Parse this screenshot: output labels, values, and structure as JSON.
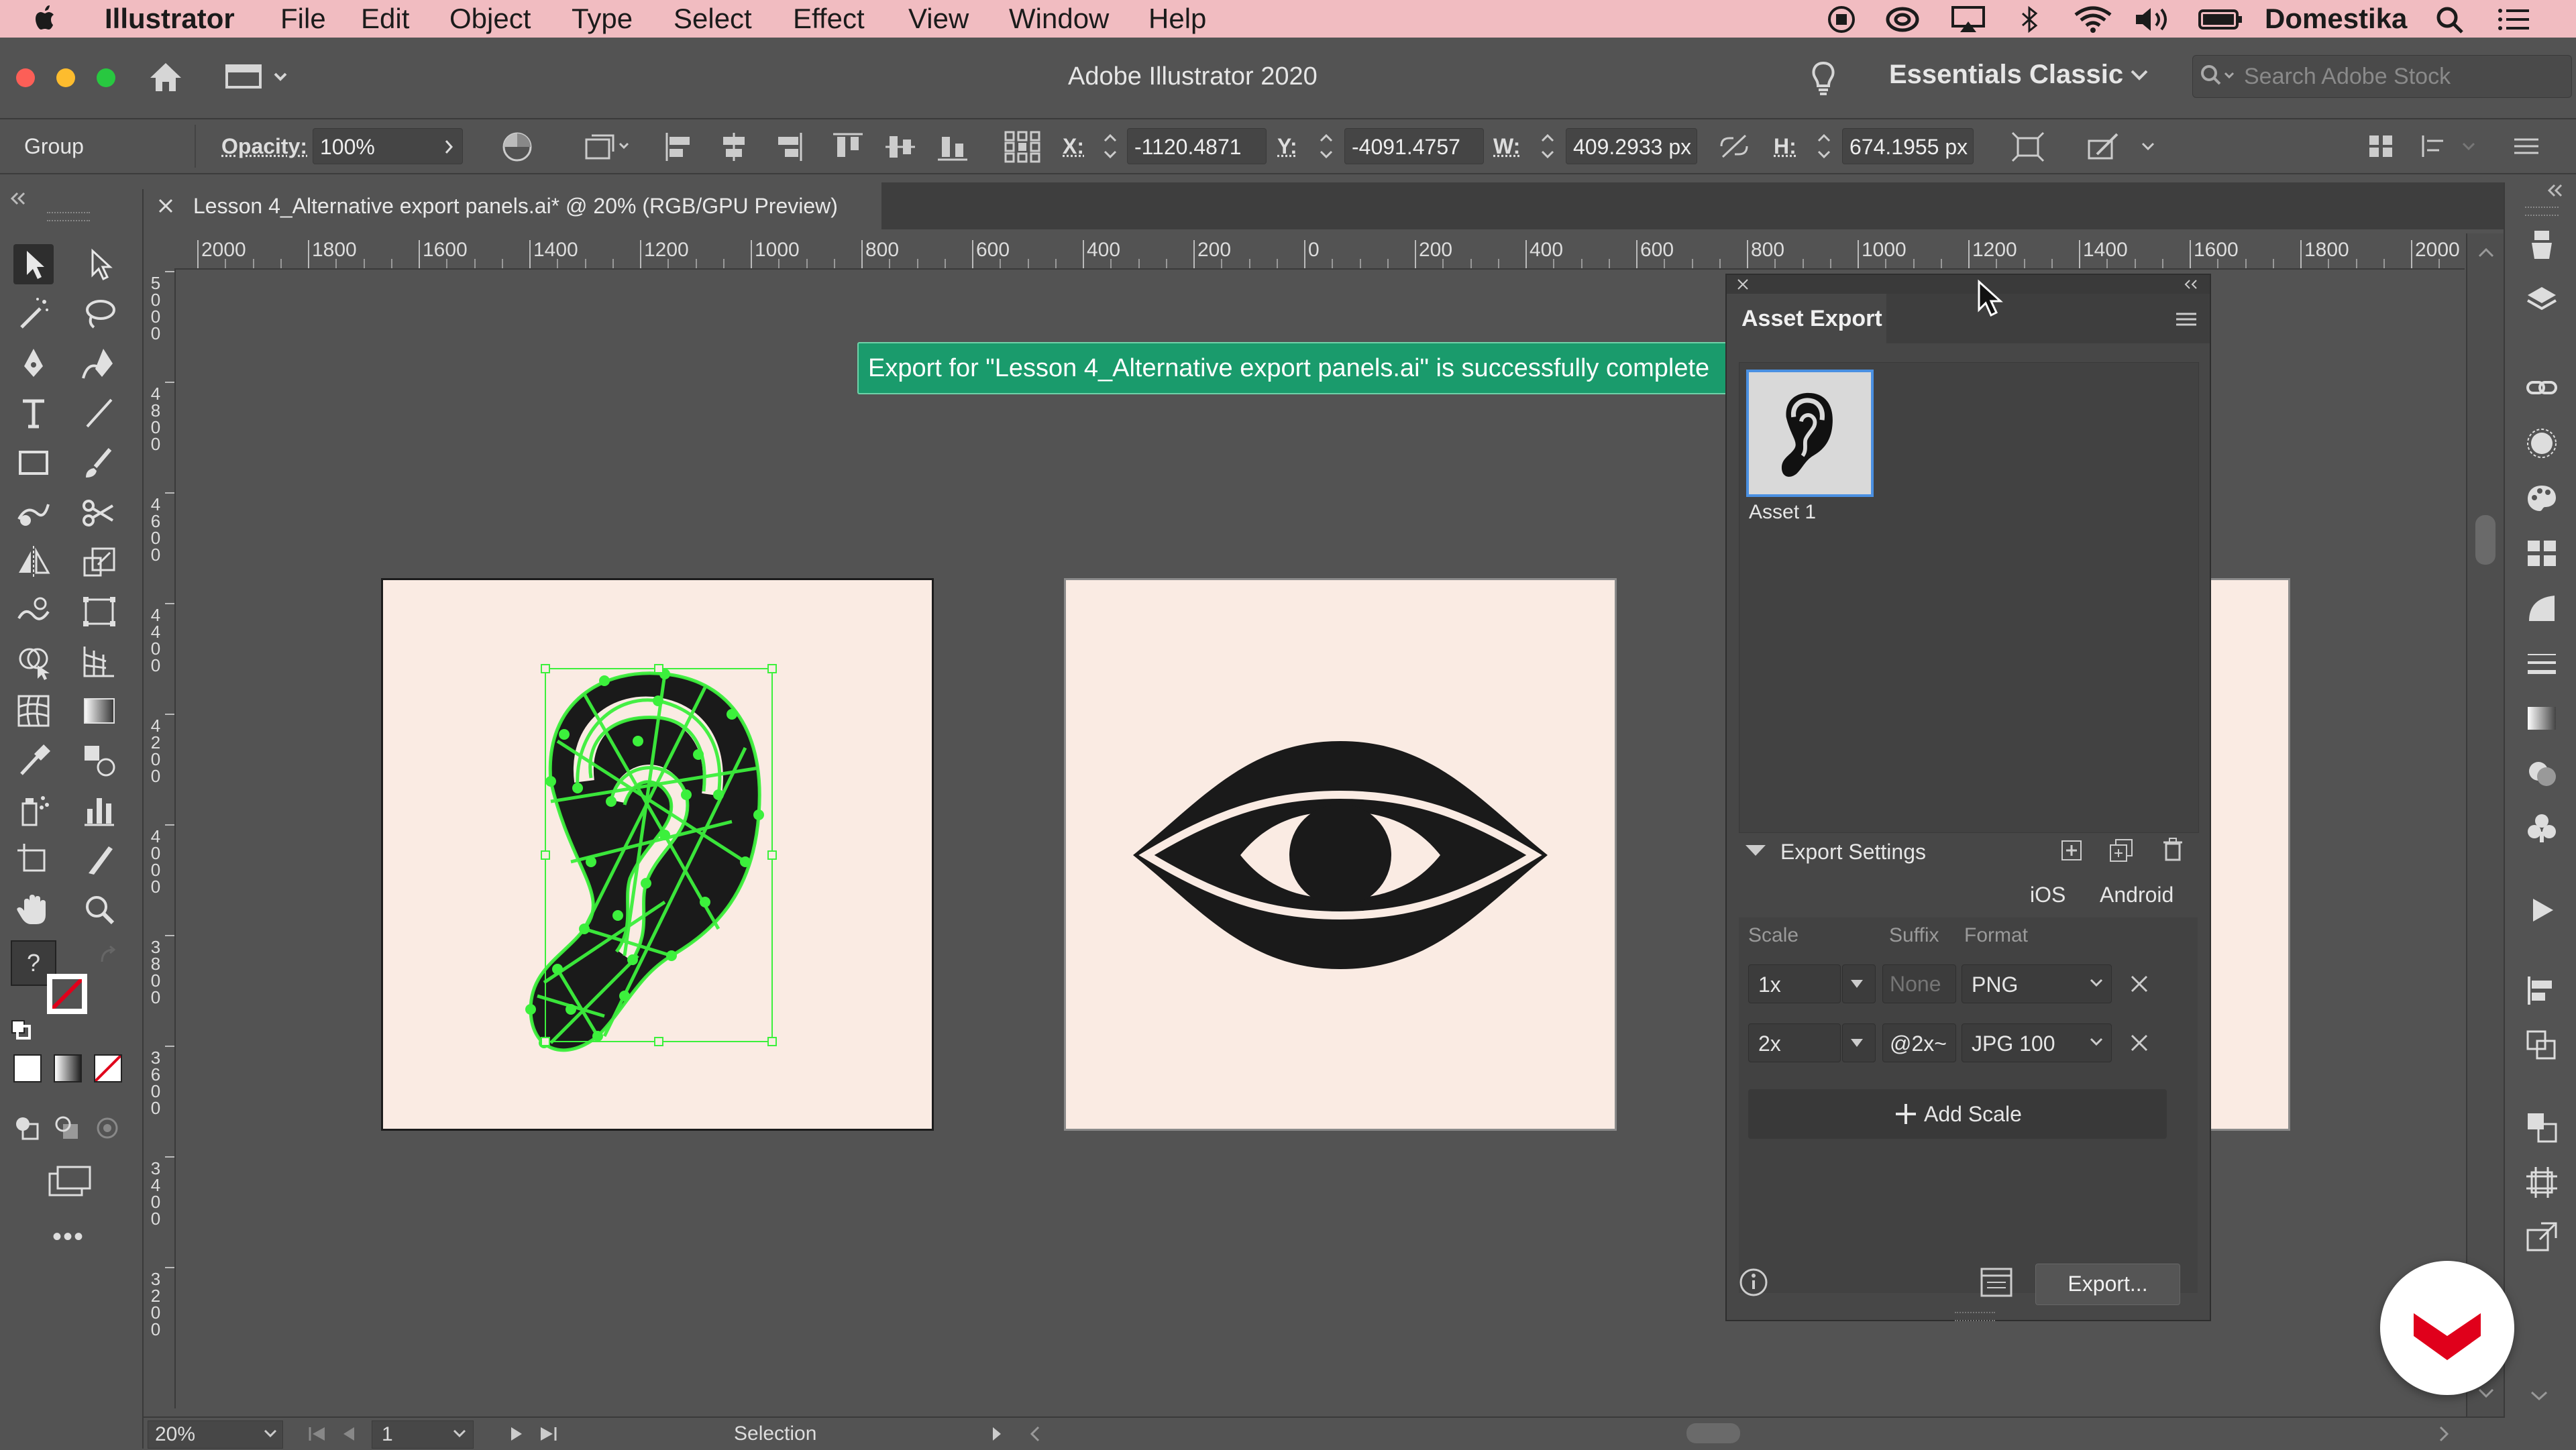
{
  "menubar": {
    "app_name": "Illustrator",
    "items": [
      "File",
      "Edit",
      "Object",
      "Type",
      "Select",
      "Effect",
      "View",
      "Window",
      "Help"
    ],
    "user": "Domestika"
  },
  "titlebar": {
    "title": "Adobe Illustrator 2020",
    "workspace": "Essentials Classic",
    "search_placeholder": "Search Adobe Stock"
  },
  "controlbar": {
    "selection_type": "Group",
    "opacity_label": "Opacity:",
    "opacity_value": "100%",
    "x_label": "X:",
    "x_value": "-1120.4871",
    "y_label": "Y:",
    "y_value": "-4091.4757",
    "w_label": "W:",
    "w_value": "409.2933 px",
    "h_label": "H:",
    "h_value": "674.1955 px"
  },
  "document_tab": {
    "title": "Lesson 4_Alternative export panels.ai* @ 20% (RGB/GPU Preview)"
  },
  "rulers": {
    "horizontal": [
      "2000",
      "1800",
      "1600",
      "1400",
      "1200",
      "1000",
      "800",
      "600",
      "400",
      "200",
      "0",
      "200",
      "400",
      "600",
      "800",
      "1000",
      "1200",
      "1400",
      "1600",
      "1800",
      "2000"
    ],
    "vertical": [
      "5000",
      "4800",
      "4600",
      "4400",
      "4200",
      "4000",
      "3800",
      "3600",
      "3400",
      "3200"
    ]
  },
  "notification": {
    "text": "Export for \"Lesson 4_Alternative export panels.ai\" is successfully complete"
  },
  "asset_export_panel": {
    "title": "Asset Export",
    "asset_name": "Asset 1",
    "export_settings_label": "Export Settings",
    "platforms": [
      "iOS",
      "Android"
    ],
    "columns": {
      "scale": "Scale",
      "suffix": "Suffix",
      "format": "Format"
    },
    "rows": [
      {
        "scale": "1x",
        "suffix": "",
        "suffix_placeholder": "None",
        "format": "PNG"
      },
      {
        "scale": "2x",
        "suffix": "@2x~",
        "suffix_placeholder": "",
        "format": "JPG 100"
      }
    ],
    "add_scale_label": "Add Scale",
    "export_button": "Export..."
  },
  "statusbar": {
    "zoom": "20%",
    "artboard_number": "1",
    "tool_name": "Selection"
  },
  "colors": {
    "menubar": "#f1bcc1",
    "ui_bg": "#535353",
    "panel_bg": "#474747",
    "artboard": "#faebe3",
    "selection_path": "#3cf03c",
    "notification": "#1a9b6c",
    "accent_blue": "#4a90e2",
    "brand_red": "#e0001b"
  },
  "icons": [
    "apple-icon",
    "home-icon",
    "lightbulb-icon",
    "search-icon",
    "selection-tool-icon",
    "direct-selection-tool-icon",
    "pen-tool-icon",
    "type-tool-icon",
    "rectangle-tool-icon",
    "brush-tool-icon",
    "hand-tool-icon",
    "zoom-tool-icon",
    "info-icon",
    "domestika-logo"
  ]
}
